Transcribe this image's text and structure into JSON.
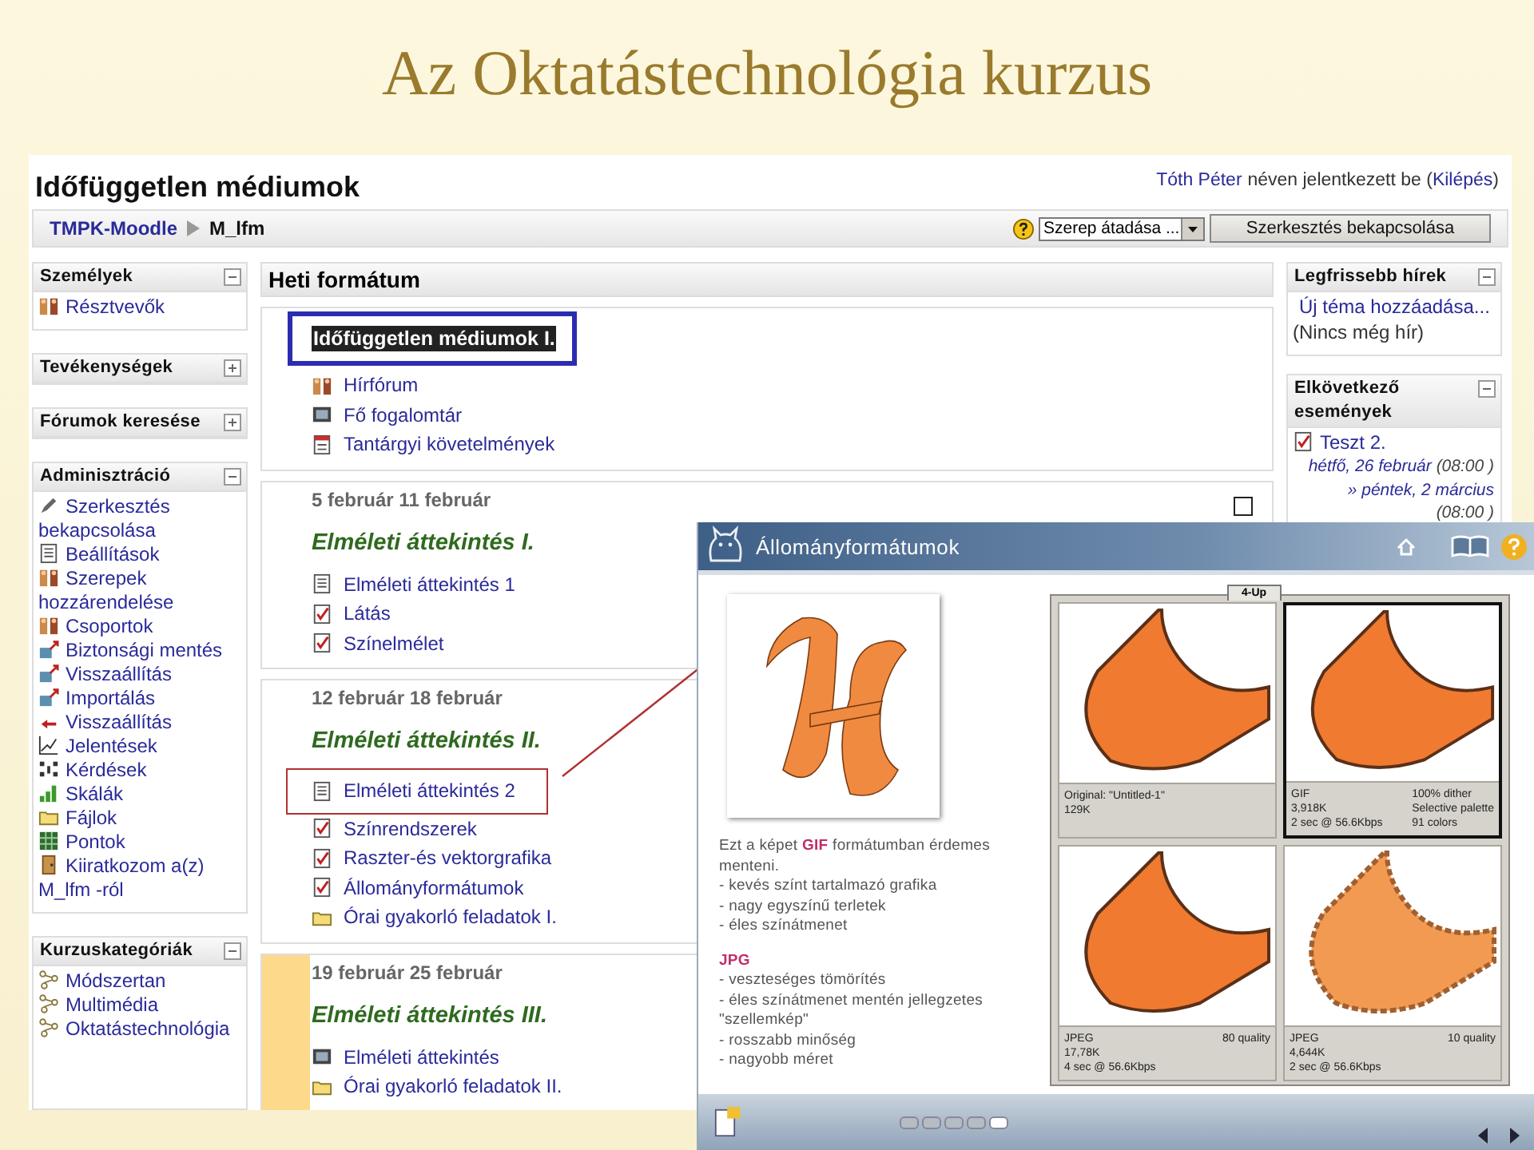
{
  "slide_title": "Az Oktatástechnológia kurzus",
  "header": {
    "site_title": "Időfüggetlen médiumok",
    "login": {
      "user": "Tóth Péter",
      "status": "néven jelentkezett be (",
      "logout": "Kilépés",
      "close": ")"
    }
  },
  "breadcrumb": [
    {
      "label": "TMPK-Moodle",
      "kind": "link"
    },
    {
      "label": "M_lfm",
      "kind": "current"
    }
  ],
  "role_select": {
    "value": "Szerep átadása ..."
  },
  "edit_button": "Szerkesztés bekapcsolása",
  "left_blocks": [
    {
      "title": "Személyek",
      "expanded": true,
      "items": [
        {
          "label": "Résztvevők",
          "kind": "people"
        }
      ]
    },
    {
      "title": "Tevékenységek",
      "expanded": false
    },
    {
      "title": "Fórumok keresése",
      "expanded": false
    },
    {
      "title": "Adminisztráció",
      "expanded": true,
      "items": [
        {
          "label": "Szerkesztés bekapcsolása",
          "kind": "pencil"
        },
        {
          "label": "Beállítások",
          "kind": "document"
        },
        {
          "label": "Szerepek hozzárendelése",
          "kind": "people"
        },
        {
          "label": "Csoportok",
          "kind": "people"
        },
        {
          "label": "Biztonsági mentés",
          "kind": "box"
        },
        {
          "label": "Visszaállítás",
          "kind": "box"
        },
        {
          "label": "Importálás",
          "kind": "box"
        },
        {
          "label": "Visszaállítás",
          "kind": "arrow"
        },
        {
          "label": "Jelentések",
          "kind": "chart"
        },
        {
          "label": "Kérdések",
          "kind": "questions"
        },
        {
          "label": "Skálák",
          "kind": "bars"
        },
        {
          "label": "Fájlok",
          "kind": "folder"
        },
        {
          "label": "Pontok",
          "kind": "grid"
        },
        {
          "label": "Kiiratkozom a(z) M_lfm -ról",
          "kind": "door"
        }
      ]
    },
    {
      "title": "Kurzuskategóriák",
      "expanded": true,
      "items": [
        {
          "label": "Módszertan",
          "kind": "nodes"
        },
        {
          "label": "Multimédia",
          "kind": "nodes"
        },
        {
          "label": "Oktatástechnológia",
          "kind": "nodes"
        }
      ]
    }
  ],
  "course": {
    "title": "Heti formátum",
    "sections": [
      {
        "kind": "intro",
        "heading": "Időfüggetlen médiumok I.",
        "framed": true,
        "current": false,
        "focus_icon": false,
        "items": [
          {
            "label": "Hírfórum",
            "kind": "people",
            "framed": false
          },
          {
            "label": "Fő fogalomtár",
            "kind": "book",
            "framed": false
          },
          {
            "label": "Tantárgyi követelmények",
            "kind": "calendar",
            "framed": false
          }
        ]
      },
      {
        "kind": "week",
        "dates": "5 február 11 február",
        "heading": "Elméleti áttekintés I.",
        "current": false,
        "focus_icon": true,
        "items": [
          {
            "label": "Elméleti áttekintés 1",
            "kind": "document",
            "framed": false
          },
          {
            "label": "Látás",
            "kind": "check",
            "framed": false
          },
          {
            "label": "Színelmélet",
            "kind": "check",
            "framed": false
          }
        ]
      },
      {
        "kind": "week",
        "dates": "12 február 18 február",
        "heading": "Elméleti áttekintés II.",
        "current": false,
        "focus_icon": false,
        "items": [
          {
            "label": "Elméleti áttekintés 2",
            "kind": "document",
            "framed": true
          },
          {
            "label": "Színrendszerek",
            "kind": "check",
            "framed": false
          },
          {
            "label": "Raszter-és vektorgrafika",
            "kind": "check",
            "framed": false
          },
          {
            "label": "Állományformátumok",
            "kind": "check",
            "framed": false
          },
          {
            "label": "Órai gyakorló feladatok I.",
            "kind": "folder",
            "framed": false
          }
        ]
      },
      {
        "kind": "week",
        "dates": "19 február 25 február",
        "heading": "Elméleti áttekintés III.",
        "current": true,
        "focus_icon": false,
        "items": [
          {
            "label": "Elméleti áttekintés",
            "kind": "book",
            "framed": false
          },
          {
            "label": "Órai gyakorló feladatok II.",
            "kind": "folder",
            "framed": false
          }
        ]
      }
    ]
  },
  "news": {
    "title": "Legfrissebb hírek",
    "expanded": true,
    "add_link": "Új téma hozzáadása...",
    "empty_note": "(Nincs még hír)"
  },
  "events": {
    "title": "Elkövetkező események",
    "expanded": true,
    "items": [
      {
        "name": "Teszt 2.",
        "kind": "check",
        "dates": [
          {
            "date": "hétfő, 26 február",
            "time": "(08:00 )"
          },
          {
            "date": "» péntek, 2 március",
            "time": "(08:00 )"
          }
        ]
      }
    ]
  },
  "popup": {
    "title": "Állományformátumok",
    "text": [
      {
        "kind": "paragraph",
        "text": "Ezt a képet **GIF** formátumban érdemes menteni."
      },
      {
        "kind": "line",
        "text": "- kevés színt tartalmazó grafika"
      },
      {
        "kind": "line",
        "text": "- nagy egyszínű terletek"
      },
      {
        "kind": "line",
        "text": "- éles színátmenet"
      },
      {
        "kind": "heading",
        "text": "JPG"
      },
      {
        "kind": "line",
        "text": "- veszteséges tömörítés"
      },
      {
        "kind": "line",
        "text": "- éles színátmenet mentén jellegzetes \"szellemkép\""
      },
      {
        "kind": "line",
        "text": "- rosszabb minőség"
      },
      {
        "kind": "line",
        "text": "- nagyobb méret"
      }
    ],
    "tab": "4-Up",
    "previews": [
      {
        "kind": "sharp",
        "selected": false,
        "left": [
          "Original: \"Untitled-1\"",
          "129K"
        ]
      },
      {
        "kind": "sharp",
        "selected": true,
        "left": [
          "GIF",
          "3,918K",
          "2 sec @ 56.6Kbps"
        ],
        "right": [
          "100% dither",
          "Selective palette",
          "91 colors"
        ]
      },
      {
        "kind": "sharp",
        "selected": false,
        "left": [
          "JPEG",
          "17,78K",
          "4 sec @ 56.6Kbps"
        ],
        "right": [
          "80 quality"
        ]
      },
      {
        "kind": "noisy",
        "selected": false,
        "left": [
          "JPEG",
          "4,644K",
          "2 sec @ 56.6Kbps"
        ],
        "right": [
          "10 quality"
        ]
      }
    ],
    "pages": [
      {
        "selected": false
      },
      {
        "selected": false
      },
      {
        "selected": false
      },
      {
        "selected": false
      },
      {
        "selected": true
      }
    ]
  }
}
